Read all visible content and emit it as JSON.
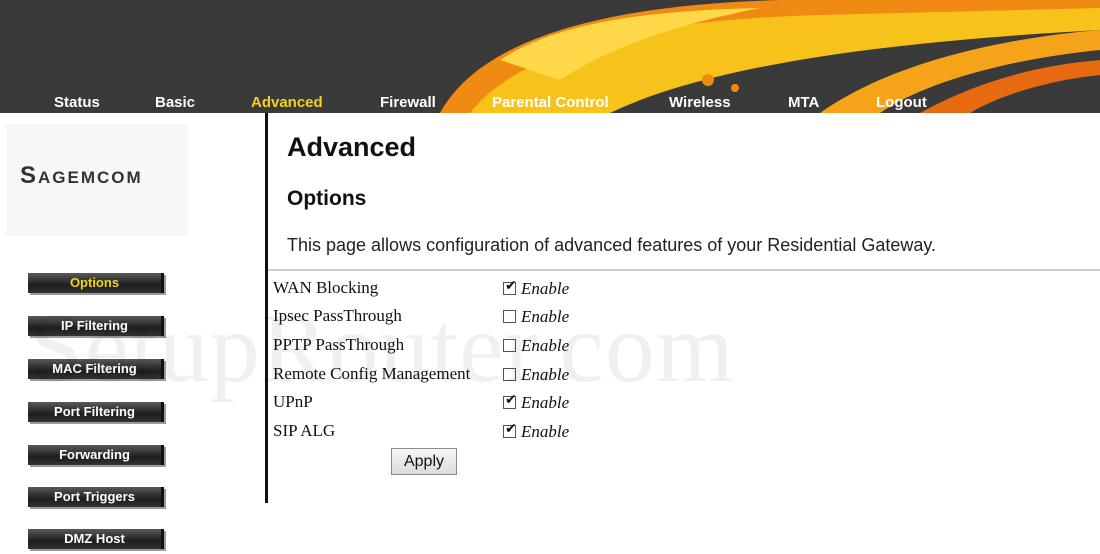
{
  "topnav": {
    "items": [
      "Status",
      "Basic",
      "Advanced",
      "Firewall",
      "Parental Control",
      "Wireless",
      "MTA",
      "Logout"
    ],
    "active": "Advanced"
  },
  "logo": {
    "text": "Sagemcom"
  },
  "sidebar": {
    "items": [
      "Options",
      "IP Filtering",
      "MAC Filtering",
      "Port Filtering",
      "Forwarding",
      "Port Triggers",
      "DMZ Host"
    ],
    "active": "Options"
  },
  "main": {
    "title": "Advanced",
    "section": "Options",
    "description": "This page allows configuration of advanced features of your Residential Gateway.",
    "options": [
      {
        "label": "WAN Blocking",
        "enable_label": "Enable",
        "checked": true
      },
      {
        "label": "Ipsec PassThrough",
        "enable_label": "Enable",
        "checked": false
      },
      {
        "label": "PPTP PassThrough",
        "enable_label": "Enable",
        "checked": false
      },
      {
        "label": "Remote Config Management",
        "enable_label": "Enable",
        "checked": false
      },
      {
        "label": "UPnP",
        "enable_label": "Enable",
        "checked": true
      },
      {
        "label": "SIP ALG",
        "enable_label": "Enable",
        "checked": true
      }
    ],
    "apply_label": "Apply"
  },
  "watermark": {
    "text": "SetupRouter.com"
  },
  "colors": {
    "header_bg": "#3a3a3a",
    "active_nav": "#f2d21a",
    "swoosh_orange": "#f08a12",
    "swoosh_yellow": "#f7c21a"
  }
}
